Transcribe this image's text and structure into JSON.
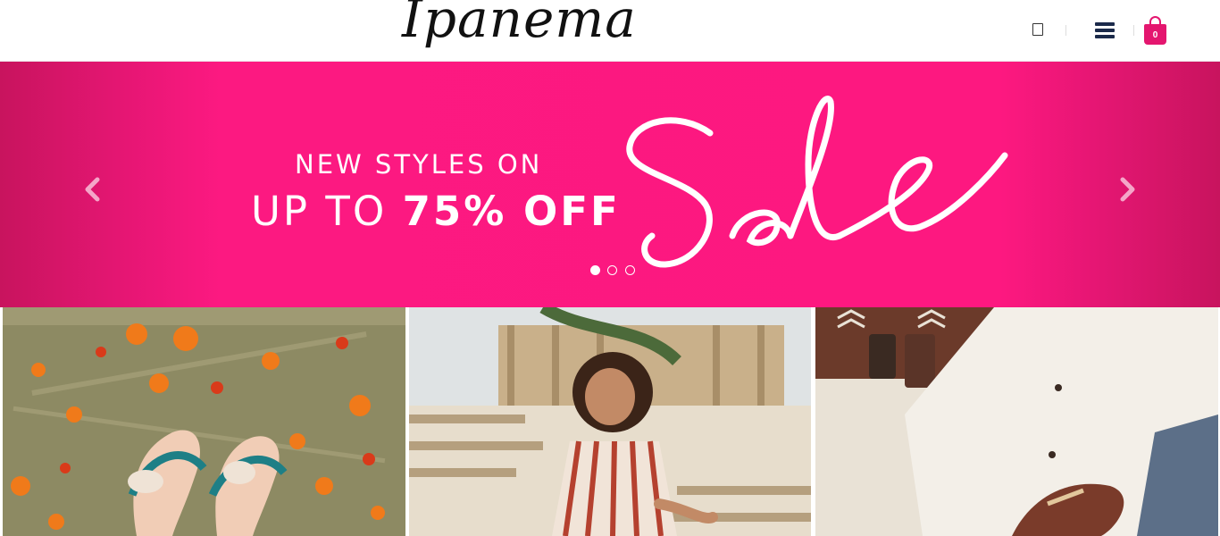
{
  "header": {
    "logo_text": "Ipanema",
    "cart_count": "0",
    "icons": {
      "small": "phone-icon",
      "menu": "hamburger-menu-icon",
      "cart": "shopping-bag-icon"
    }
  },
  "banner": {
    "line1": "NEW STYLES ON",
    "line2_prefix": "UP TO ",
    "line2_bold": "75% OFF",
    "script_text": "Sale",
    "background_color": "#fc1981",
    "text_color": "#ffffff",
    "slides_total": 3,
    "active_slide": 1
  },
  "tiles": [
    {
      "name": "flip-flops-on-grass"
    },
    {
      "name": "girl-on-boardwalk"
    },
    {
      "name": "flat-lay-with-sandals"
    }
  ],
  "colors": {
    "brand_pink": "#e4166f",
    "menu_navy": "#1b2a4a"
  }
}
